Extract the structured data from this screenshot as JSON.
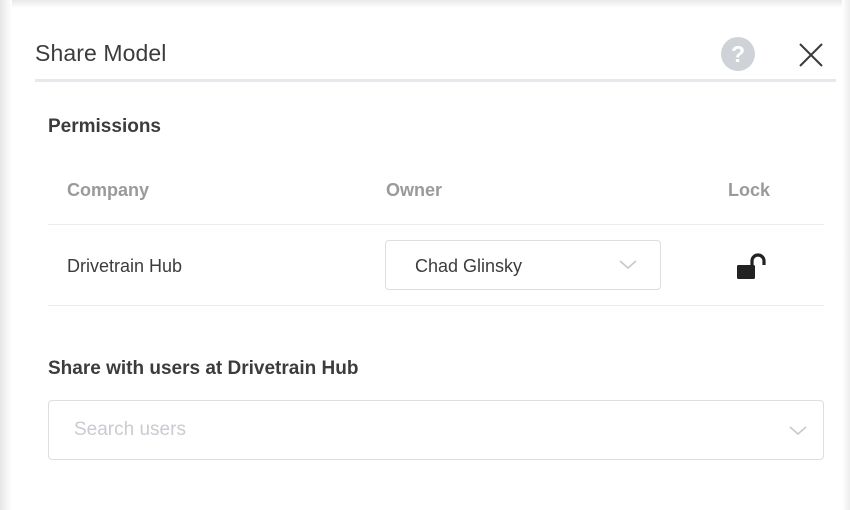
{
  "dialog": {
    "title": "Share Model",
    "help_glyph": "?",
    "icons": [
      "help-icon",
      "close-icon"
    ]
  },
  "permissions": {
    "section_title": "Permissions",
    "columns": {
      "company": "Company",
      "owner": "Owner",
      "lock": "Lock"
    },
    "rows": [
      {
        "company": "Drivetrain Hub",
        "owner": "Chad Glinsky",
        "lock_icon": "unlocked-padlock-icon"
      }
    ]
  },
  "share": {
    "section_title": "Share with users at Drivetrain Hub",
    "search_placeholder": "Search users",
    "search_value": ""
  },
  "colors": {
    "text": "#3c3c3c",
    "muted_header": "#9a9a9a",
    "help_bg": "#cfd3d8",
    "border": "#dedede",
    "placeholder": "#c8ccd1"
  }
}
